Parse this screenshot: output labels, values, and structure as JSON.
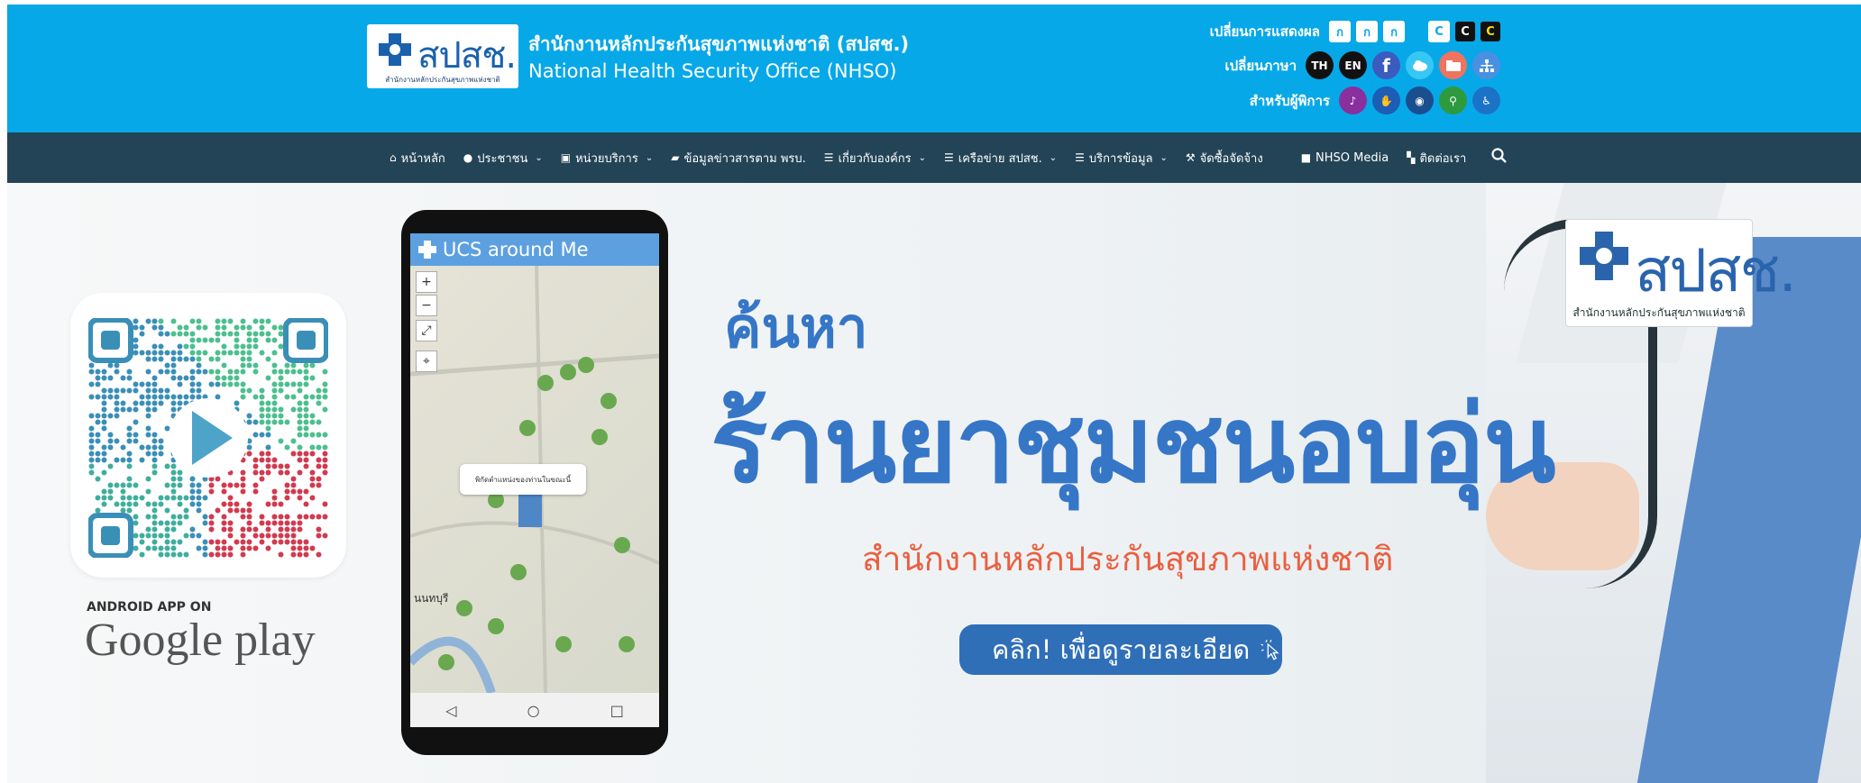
{
  "header": {
    "logo_text": "สปสช.",
    "logo_subtext": "สำนักงานหลักประกันสุขภาพแห่งชาติ",
    "org_name_th": "สำนักงานหลักประกันสุขภาพแห่งชาติ (สปสช.)",
    "org_name_en": "National Health Security Office (NHSO)",
    "display_label": "เปลี่ยนการแสดงผล",
    "font_size_options": [
      "ก",
      "ก",
      "ก"
    ],
    "contrast_options": [
      "C",
      "C",
      "C"
    ],
    "language_label": "เปลี่ยนภาษา",
    "languages": [
      "TH",
      "EN"
    ],
    "accessibility_label": "สำหรับผู้พิการ",
    "social_icons": [
      "facebook-icon",
      "cloud-icon",
      "folder-icon",
      "sitemap-icon"
    ],
    "disability_icons": [
      "hearing-icon",
      "sign-language-icon",
      "cognitive-icon",
      "blind-walking-icon",
      "wheelchair-icon"
    ]
  },
  "nav": {
    "items": [
      {
        "label": "หน้าหลัก",
        "icon": "home-icon",
        "dropdown": false
      },
      {
        "label": "ประชาชน",
        "icon": "user-icon",
        "dropdown": true
      },
      {
        "label": "หน่วยบริการ",
        "icon": "hospital-icon",
        "dropdown": true
      },
      {
        "label": "ข้อมูลข่าวสารตาม พรบ.",
        "icon": "book-icon",
        "dropdown": false
      },
      {
        "label": "เกี่ยวกับองค์กร",
        "icon": "list-icon",
        "dropdown": true
      },
      {
        "label": "เครือข่าย สปสช.",
        "icon": "list-icon",
        "dropdown": true
      },
      {
        "label": "บริการข้อมูล",
        "icon": "list-icon",
        "dropdown": true
      },
      {
        "label": "จัดซื้อจัดจ้าง",
        "icon": "gavel-icon",
        "dropdown": false
      },
      {
        "label": "NHSO Media",
        "icon": "video-icon",
        "dropdown": false
      },
      {
        "label": "ติดต่อเรา",
        "icon": "map-icon",
        "dropdown": false
      }
    ],
    "search_icon": "search-icon"
  },
  "banner": {
    "app_on": "ANDROID APP ON",
    "store_name": "Google play",
    "phone_app_title": "UCS around Me",
    "map_popup": "พิกัดตำแหน่งของท่านในขณะนี้",
    "map_place": "นนทบุรี",
    "headline_small": "ค้นหา",
    "headline_main": "ร้านยาชุมชนอบอุ่น",
    "org_line": "สำนักงานหลักประกันสุขภาพแห่งชาติ",
    "cta_label": "คลิก! เพื่อดูรายละเอียด",
    "corner_logo_text": "สปสช.",
    "corner_logo_sub": "สำนักงานหลักประกันสุขภาพแห่งชาติ"
  },
  "colors": {
    "header_bg": "#07a8e8",
    "nav_bg": "#234456",
    "headline": "#3676c7",
    "org_line": "#ea5f3f",
    "cta_bg": "#2f6fb8"
  }
}
